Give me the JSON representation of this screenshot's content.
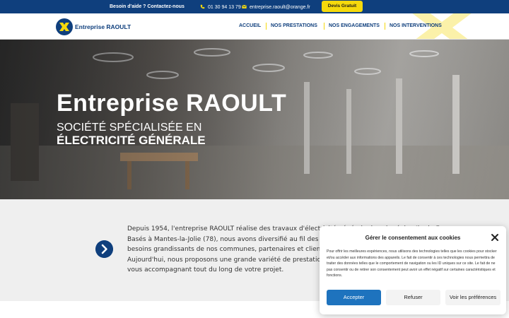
{
  "topbar": {
    "help": "Besoin d'aide ? Contactez-nous",
    "phone": "01 30 94 13 79",
    "email": "entreprise.raoult@orange.fr",
    "devis": "Devis Gratuit"
  },
  "header": {
    "brand": "Entreprise RAOULT",
    "nav": [
      "ACCUEIL",
      "NOS PRESTATIONS",
      "NOS ENGAGEMENTS",
      "NOS INTERVENTIONS"
    ]
  },
  "hero": {
    "title": "Entreprise RAOULT",
    "subtitle_line1": "SOCIÉTÉ SPÉCIALISÉE EN",
    "subtitle_line2": "ÉLECTRICITÉ GÉNÉRALE"
  },
  "about": {
    "lines": [
      "Depuis 1954, l'entreprise RAOULT réalise des travaux d'électricité générale dans la région Ile-de-France.",
      "Basés à Mantes-la-Jolie (78), nous avons diversifié au fil des an",
      "besoins grandissants de nos communes, partenaires et clients,",
      "Aujourd'hui, nous proposons une grande variété de prestations",
      "vous accompagnant tout du long de votre projet."
    ]
  },
  "consent": {
    "title": "Gérer le consentement aux cookies",
    "body": "Pour offrir les meilleures expériences, nous utilisons des technologies telles que les cookies pour stocker et/ou accéder aux informations des appareils. Le fait de consentir à ces technologies nous permettra de traiter des données telles que le comportement de navigation ou les ID uniques sur ce site. Le fait de ne pas consentir ou de retirer son consentement peut avoir un effet négatif sur certaines caractéristiques et fonctions.",
    "accept": "Accepter",
    "refuse": "Refuser",
    "prefs": "Voir les préférences"
  },
  "colors": {
    "primary": "#0f3f7d",
    "accent_yellow": "#f5d90c",
    "button_blue": "#1e73be"
  }
}
